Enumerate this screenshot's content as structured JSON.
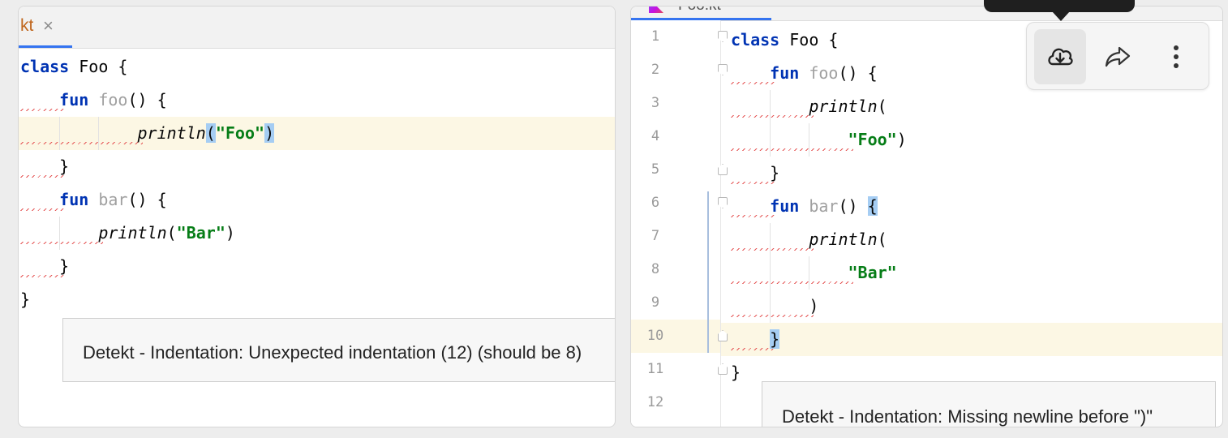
{
  "left_editor": {
    "tab": {
      "label": "kt",
      "close": "×"
    },
    "lines": [
      {
        "indent": "",
        "tokens": [
          {
            "t": "class",
            "c": "kw"
          },
          {
            "t": " Foo {"
          }
        ]
      },
      {
        "indent": "    ",
        "tokens": [
          {
            "t": "fun",
            "c": "kw"
          },
          {
            "t": " "
          },
          {
            "t": "foo",
            "c": "fnname"
          },
          {
            "t": "() {"
          }
        ]
      },
      {
        "indent": "            ",
        "tokens": [
          {
            "t": "println",
            "c": "call"
          },
          {
            "t": "(",
            "c": "brk"
          },
          {
            "t": "\"Foo\"",
            "c": "str"
          },
          {
            "t": ")",
            "c": "brk"
          }
        ]
      },
      {
        "indent": "    ",
        "tokens": [
          {
            "t": "}"
          }
        ]
      },
      {
        "indent": "    ",
        "tokens": [
          {
            "t": "fun",
            "c": "kw"
          },
          {
            "t": " "
          },
          {
            "t": "bar",
            "c": "fnname"
          },
          {
            "t": "() {"
          }
        ]
      },
      {
        "indent": "        ",
        "tokens": [
          {
            "t": "println",
            "c": "call"
          },
          {
            "t": "("
          },
          {
            "t": "\"Bar\"",
            "c": "str"
          },
          {
            "t": ")"
          }
        ]
      },
      {
        "indent": "    ",
        "tokens": [
          {
            "t": "}"
          }
        ]
      },
      {
        "indent": "",
        "tokens": [
          {
            "t": "}"
          }
        ]
      }
    ],
    "tooltip": "Detekt - Indentation: Unexpected indentation (12) (should be 8)"
  },
  "right_editor": {
    "tab": {
      "label": "Foo.kt"
    },
    "line_numbers": [
      "1",
      "2",
      "3",
      "4",
      "5",
      "6",
      "7",
      "8",
      "9",
      "10",
      "11",
      "12"
    ],
    "lines": [
      {
        "indent": "",
        "tokens": [
          {
            "t": "class",
            "c": "kw"
          },
          {
            "t": " Foo {"
          }
        ]
      },
      {
        "indent": "    ",
        "tokens": [
          {
            "t": "fun",
            "c": "kw"
          },
          {
            "t": " "
          },
          {
            "t": "foo",
            "c": "fnname"
          },
          {
            "t": "() {"
          }
        ]
      },
      {
        "indent": "        ",
        "tokens": [
          {
            "t": "println",
            "c": "call"
          },
          {
            "t": "("
          }
        ]
      },
      {
        "indent": "            ",
        "tokens": [
          {
            "t": "\"Foo\"",
            "c": "str"
          },
          {
            "t": ")"
          }
        ]
      },
      {
        "indent": "    ",
        "tokens": [
          {
            "t": "}"
          }
        ]
      },
      {
        "indent": "    ",
        "tokens": [
          {
            "t": "fun",
            "c": "kw"
          },
          {
            "t": " "
          },
          {
            "t": "bar",
            "c": "fnname"
          },
          {
            "t": "() "
          },
          {
            "t": "{",
            "c": "brk"
          }
        ]
      },
      {
        "indent": "        ",
        "tokens": [
          {
            "t": "println",
            "c": "call"
          },
          {
            "t": "("
          }
        ]
      },
      {
        "indent": "            ",
        "tokens": [
          {
            "t": "\"Bar\"",
            "c": "str"
          }
        ]
      },
      {
        "indent": "        ",
        "tokens": [
          {
            "t": ")"
          }
        ]
      },
      {
        "indent": "    ",
        "tokens": [
          {
            "t": "}",
            "c": "brk"
          }
        ]
      },
      {
        "indent": "",
        "tokens": [
          {
            "t": "}"
          }
        ]
      },
      {
        "indent": "",
        "tokens": []
      }
    ],
    "tooltip": "Detekt - Indentation: Missing newline before \")\""
  },
  "toolbar": {
    "download_icon": "cloud-download-icon",
    "share_icon": "share-arrow-icon",
    "more_icon": "vertical-dots-icon"
  },
  "colors": {
    "keyword": "#0033b3",
    "string": "#067d17",
    "current_line": "#fcf7e4",
    "bracket_match": "#a5cdf3",
    "error_underline": "#e55656",
    "tab_underline": "#3574f0"
  }
}
